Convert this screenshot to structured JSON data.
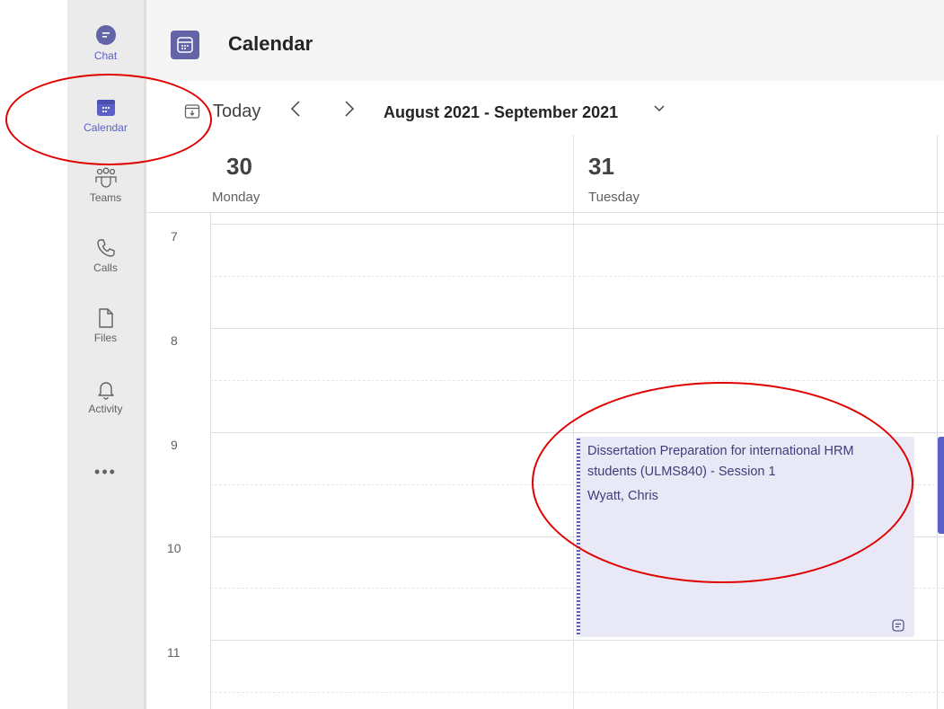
{
  "rail": {
    "items": [
      {
        "label": "Chat",
        "icon": "chat-icon"
      },
      {
        "label": "Calendar",
        "icon": "calendar-icon",
        "active": true
      },
      {
        "label": "Teams",
        "icon": "teams-icon"
      },
      {
        "label": "Calls",
        "icon": "phone-icon"
      },
      {
        "label": "Files",
        "icon": "file-icon"
      },
      {
        "label": "Activity",
        "icon": "bell-icon"
      }
    ],
    "more": "•••"
  },
  "header": {
    "title": "Calendar"
  },
  "toolbar": {
    "today": "Today",
    "prev": "‹",
    "next": "›",
    "range": "August 2021 - September 2021",
    "range_dropdown": "⌄"
  },
  "days": [
    {
      "num": "30",
      "name": "Monday"
    },
    {
      "num": "31",
      "name": "Tuesday"
    }
  ],
  "hours": [
    "7",
    "8",
    "9",
    "10",
    "11"
  ],
  "event": {
    "title": "Dissertation Preparation for international HRM students (ULMS840) - Session 1",
    "organizer": "Wyatt, Chris"
  },
  "colors": {
    "accent": "#6264a7",
    "event_bg": "#e8e8f7",
    "annotation": "#e00000"
  }
}
